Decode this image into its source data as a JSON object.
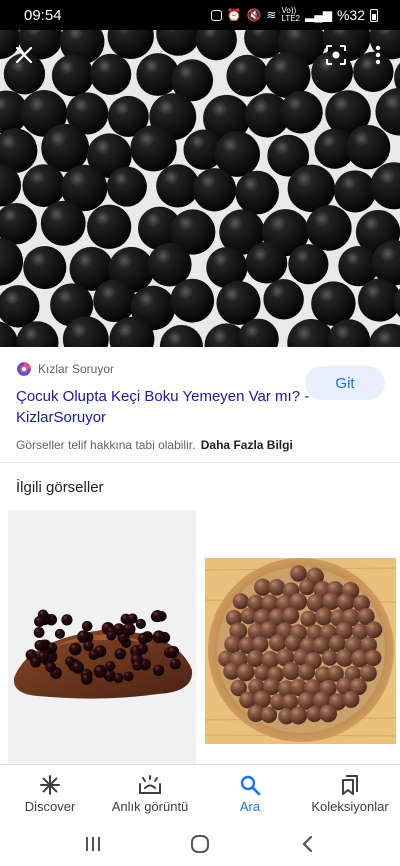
{
  "status_bar": {
    "time": "09:54",
    "network": "Vo))\nLTE2",
    "battery": "%32"
  },
  "hero": {
    "close_icon": "close-icon",
    "lens_icon": "lens-icon",
    "more_icon": "more-vert-icon"
  },
  "result": {
    "source": "Kızlar Soruyor",
    "title": "Çocuk Olupta Keçi Boku Yemeyen Var mı? - KizlarSoruyor",
    "visit_label": "Git",
    "copyright": "Görseller telif hakkına tabi olabilir.",
    "more_info": "Daha Fazla Bilgi"
  },
  "related": {
    "heading": "İlgili görseller"
  },
  "bottom_nav": {
    "items": [
      {
        "label": "Discover",
        "icon": "asterisk-icon"
      },
      {
        "label": "Anlık görüntü",
        "icon": "snapshot-icon"
      },
      {
        "label": "Ara",
        "icon": "search-icon"
      },
      {
        "label": "Koleksiyonlar",
        "icon": "collections-icon"
      }
    ],
    "active": "Ara"
  },
  "system_nav": {
    "recent": "recent-apps-icon",
    "home": "home-icon",
    "back": "back-icon"
  },
  "colors": {
    "accent": "#1a73e8",
    "visit_bg": "#e8f0fe",
    "title": "#1a1aa6"
  }
}
